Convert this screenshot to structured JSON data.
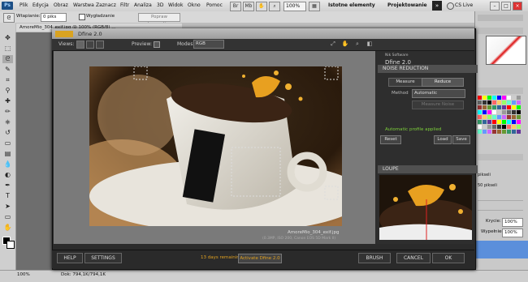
{
  "menubar": {
    "logo": "Ps",
    "items": [
      "Plik",
      "Edycja",
      "Obraz",
      "Warstwa",
      "Zaznacz",
      "Filtr",
      "Analiza",
      "3D",
      "Widok",
      "Okno",
      "Pomoc"
    ],
    "zoom": "100%",
    "workspace_essentials": "Istotne elementy",
    "workspace_design": "Projektowanie",
    "more": "»",
    "cs_live": "CS Live"
  },
  "options": {
    "feather_label": "Wtapianie:",
    "feather_value": "0 piks",
    "smooth_label": "Wygładzanie",
    "refine_edge": "Popraw krawędź..."
  },
  "document": {
    "tab": "AmoreMio_304_exif.jpg @ 100% (RGB/8) ..."
  },
  "status": {
    "zoom": "100%",
    "doc": "Dok: 794,1K/794,1K"
  },
  "right_panels": {
    "rows": [
      "pikseli",
      "50 pikseli"
    ],
    "opacity_label": "Krycie:",
    "opacity_value": "100%",
    "fill_label": "Wypełnienie:",
    "fill_value": "100%"
  },
  "dfine": {
    "title": "Dfine 2.0",
    "views_label": "Views:",
    "preview_label": "Preview:",
    "modes_label": "Modes:",
    "mode_value": "RGB",
    "nik_label": "Nik Software",
    "product_title": "Dfine 2.0",
    "noise_reduction": "NOISE REDUCTION",
    "measure": "Measure",
    "reduce": "Reduce",
    "method_label": "Method",
    "method_value": "Automatic",
    "measure_noise": "Measure Noise",
    "profile_status": "Automatic profile applied",
    "reset": "Reset",
    "load": "Load",
    "save": "Save",
    "loupe": "LOUPE",
    "photo_name": "AmoreMio_304_exif.jpg",
    "photo_meta": "(0.3MP, ISO 200, Canon EOS 5D Mark II)",
    "help": "HELP",
    "settings": "SETTINGS",
    "trial": "13 days remaining",
    "activate": "Activate Dfine 2.0",
    "brush": "BRUSH",
    "cancel": "CANCEL",
    "ok": "OK"
  },
  "colors": {
    "accent_green": "#7ccf3a",
    "trial_orange": "#e0a020",
    "layer_selected": "#5b8fdb"
  }
}
